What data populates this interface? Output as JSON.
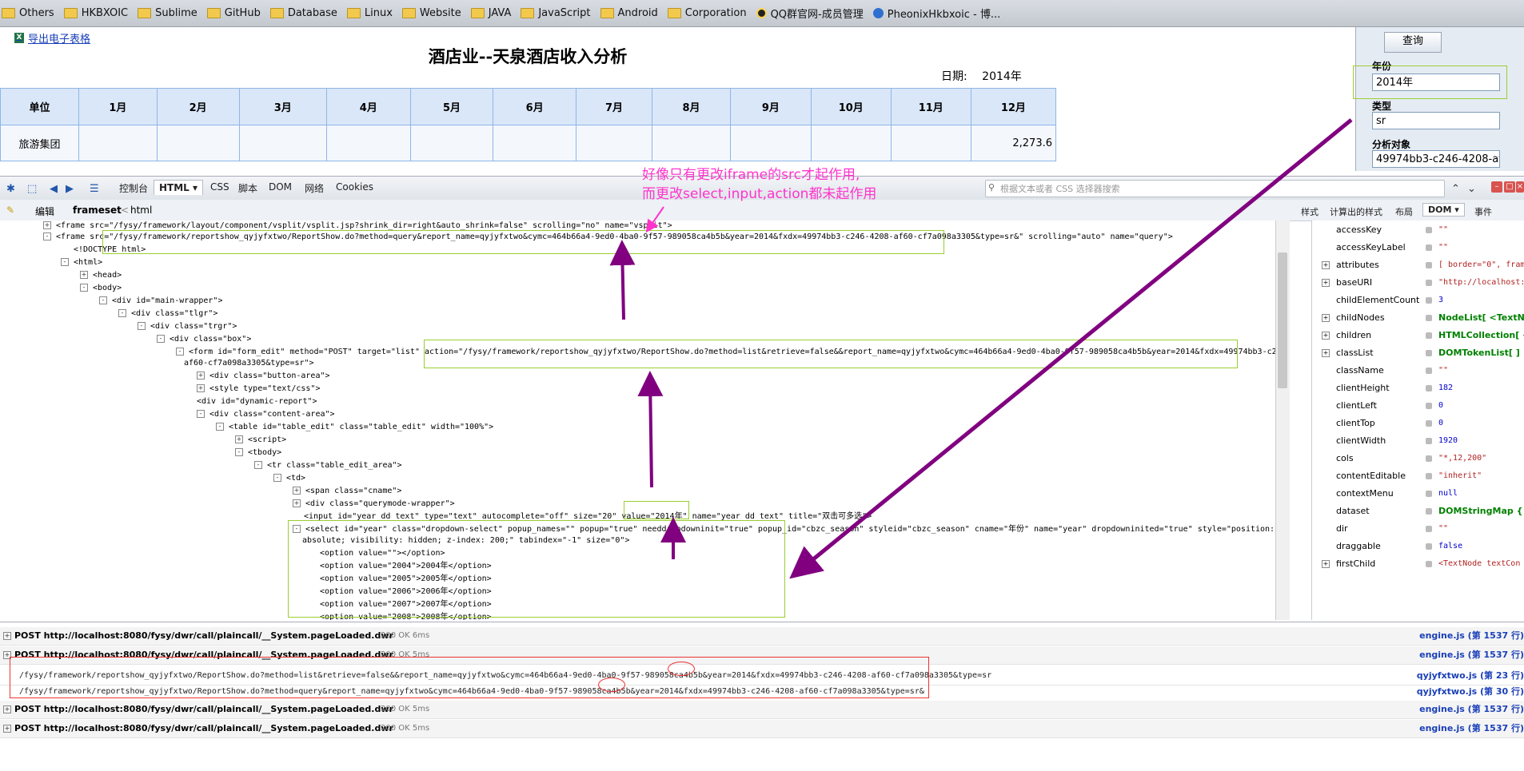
{
  "bookmarks": [
    {
      "label": "Others",
      "icon": "folder-icon"
    },
    {
      "label": "HKBXOIC",
      "icon": "folder-icon"
    },
    {
      "label": "Sublime",
      "icon": "folder-icon"
    },
    {
      "label": "GitHub",
      "icon": "folder-icon"
    },
    {
      "label": "Database",
      "icon": "folder-icon"
    },
    {
      "label": "Linux",
      "icon": "folder-icon"
    },
    {
      "label": "Website",
      "icon": "folder-icon"
    },
    {
      "label": "JAVA",
      "icon": "folder-icon"
    },
    {
      "label": "JavaScript",
      "icon": "folder-icon"
    },
    {
      "label": "Android",
      "icon": "folder-icon"
    },
    {
      "label": "Corporation",
      "icon": "folder-icon"
    },
    {
      "label": "QQ群官网-成员管理",
      "icon": "qq-icon"
    },
    {
      "label": "PheonixHkbxoic - 博...",
      "icon": "globe-icon"
    }
  ],
  "report": {
    "export_link": "导出电子表格",
    "title": "酒店业--天泉酒店收入分析",
    "date_label": "日期:",
    "date_value": "2014年",
    "headers": [
      "单位",
      "1月",
      "2月",
      "3月",
      "4月",
      "5月",
      "6月",
      "7月",
      "8月",
      "9月",
      "10月",
      "11月",
      "12月"
    ],
    "rows": [
      [
        "旅游集团",
        "",
        "",
        "",
        "",
        "",
        "",
        "",
        "",
        "",
        "",
        "",
        "2,273.6"
      ]
    ]
  },
  "query_panel": {
    "button": "查询",
    "year_label": "年份",
    "year_value": "2014年",
    "type_label": "类型",
    "type_value": "sr",
    "target_label": "分析对象",
    "target_value": "49974bb3-c246-4208-af"
  },
  "devtools": {
    "tabs": [
      "控制台",
      "HTML",
      "CSS",
      "脚本",
      "DOM",
      "网络",
      "Cookies"
    ],
    "active_tab": "HTML",
    "search_placeholder": "根据文本或者 CSS 选择器搜索",
    "edit": "编辑",
    "breadcrumb_current": "frameset",
    "breadcrumb_parent": "html",
    "side_tabs": [
      "样式",
      "计算出的样式",
      "布局",
      "DOM",
      "事件"
    ]
  },
  "annotation": {
    "line1": "好像只有更改iframe的src才起作用,",
    "line2": "而更改select,input,action都未起作用"
  },
  "tree": [
    "<frame src=\"/fysy/framework/layout/component/vsplit/vsplit.jsp?shrink_dir=right&auto_shrink=false\" scrolling=\"no\" name=\"vsplit\">",
    "<frame src=\"/fysy/framework/reportshow_qyjyfxtwo/ReportShow.do?method=query&report_name=qyjyfxtwo&cymc=464b66a4-9ed0-4ba0-9f57-989058ca4b5b&year=2014&fxdx=49974bb3-c246-4208-af60-cf7a098a3305&type=sr&\" scrolling=\"auto\" name=\"query\">",
    "<!DOCTYPE html>",
    "<html>",
    "<head>",
    "<body>",
    "<div id=\"main-wrapper\">",
    "<div class=\"tlgr\">",
    "<div class=\"trgr\">",
    "<div class=\"box\">",
    "<form id=\"form_edit\" method=\"POST\" target=\"list\" action=\"/fysy/framework/reportshow_qyjyfxtwo/ReportShow.do?method=list&retrieve=false&&report_name=qyjyfxtwo&cymc=464b66a4-9ed0-4ba0-9f57-989058ca4b5b&year=2014&fxdx=49974bb3-c246-4208-",
    "af60-cf7a098a3305&type=sr\">",
    "<div class=\"button-area\">",
    "<style type=\"text/css\">",
    "<div id=\"dynamic-report\">",
    "<div class=\"content-area\">",
    "<table id=\"table_edit\" class=\"table_edit\" width=\"100%\">",
    "<script>",
    "<tbody>",
    "<tr class=\"table_edit_area\">",
    "<td>",
    "<span class=\"cname\">",
    "<div class=\"querymode-wrapper\">",
    "<input id=\"year_dd_text\" type=\"text\" autocomplete=\"off\" size=\"20\" value=\"2014年\" name=\"year_dd_text\" title=\"双击可多选\">",
    "<select id=\"year\" class=\"dropdown-select\" popup_names=\"\" popup=\"true\" needdropdowninit=\"true\" popup_id=\"cbzc_season\" styleid=\"cbzc_season\" cname=\"年份\" name=\"year\" dropdowninited=\"true\" style=\"position:",
    "absolute; visibility: hidden; z-index: 200;\" tabindex=\"-1\" size=\"0\">",
    "<option value=\"\"></option>",
    "<option value=\"2004\">2004年</option>",
    "<option value=\"2005\">2005年</option>",
    "<option value=\"2006\">2006年</option>",
    "<option value=\"2007\">2007年</option>",
    "<option value=\"2008\">2008年</option>"
  ],
  "dom_props": [
    {
      "name": "accessKey",
      "value": "\"\"",
      "kind": "str",
      "expand": false
    },
    {
      "name": "accessKeyLabel",
      "value": "\"\"",
      "kind": "str",
      "expand": false
    },
    {
      "name": "attributes",
      "value": "[ border=\"0\", frame",
      "kind": "str",
      "expand": true
    },
    {
      "name": "baseURI",
      "value": "\"http://localhost:",
      "kind": "str",
      "expand": true
    },
    {
      "name": "childElementCount",
      "value": "3",
      "kind": "num",
      "expand": false
    },
    {
      "name": "childNodes",
      "value": "NodeList[ <TextNo",
      "kind": "obj",
      "expand": true
    },
    {
      "name": "children",
      "value": "HTMLCollection[ <f",
      "kind": "obj",
      "expand": true
    },
    {
      "name": "classList",
      "value": "DOMTokenList[ ]",
      "kind": "obj",
      "expand": true
    },
    {
      "name": "className",
      "value": "\"\"",
      "kind": "str",
      "expand": false
    },
    {
      "name": "clientHeight",
      "value": "182",
      "kind": "num",
      "expand": false
    },
    {
      "name": "clientLeft",
      "value": "0",
      "kind": "num",
      "expand": false
    },
    {
      "name": "clientTop",
      "value": "0",
      "kind": "num",
      "expand": false
    },
    {
      "name": "clientWidth",
      "value": "1920",
      "kind": "num",
      "expand": false
    },
    {
      "name": "cols",
      "value": "\"*,12,200\"",
      "kind": "str",
      "expand": false
    },
    {
      "name": "contentEditable",
      "value": "\"inherit\"",
      "kind": "str",
      "expand": false
    },
    {
      "name": "contextMenu",
      "value": "null",
      "kind": "num",
      "expand": false
    },
    {
      "name": "dataset",
      "value": "DOMStringMap {",
      "kind": "obj",
      "expand": false
    },
    {
      "name": "dir",
      "value": "\"\"",
      "kind": "str",
      "expand": false
    },
    {
      "name": "draggable",
      "value": "false",
      "kind": "num",
      "expand": false
    },
    {
      "name": "firstChild",
      "value": "<TextNode textCon",
      "kind": "str",
      "expand": true
    }
  ],
  "console": [
    {
      "type": "post",
      "text": "POST http://localhost:8080/fysy/dwr/call/plaincall/__System.pageLoaded.dwr",
      "status": "200 OK 6ms",
      "file": "engine.js (第 1537 行)"
    },
    {
      "type": "post",
      "text": "POST http://localhost:8080/fysy/dwr/call/plaincall/__System.pageLoaded.dwr",
      "status": "200 OK 5ms",
      "file": "engine.js (第 1537 行)"
    },
    {
      "type": "url",
      "text": "/fysy/framework/reportshow_qyjyfxtwo/ReportShow.do?method=list&retrieve=false&&report_name=qyjyfxtwo&cymc=464b66a4-9ed0-4ba0-9f57-989058ca4b5b&year=2014&fxdx=49974bb3-c246-4208-af60-cf7a098a3305&type=sr",
      "status": "",
      "file": "qyjyfxtwo.js (第 23 行)"
    },
    {
      "type": "url",
      "text": "/fysy/framework/reportshow_qyjyfxtwo/ReportShow.do?method=query&report_name=qyjyfxtwo&cymc=464b66a4-9ed0-4ba0-9f57-989058ca4b5b&year=2014&fxdx=49974bb3-c246-4208-af60-cf7a098a3305&type=sr&",
      "status": "",
      "file": "qyjyfxtwo.js (第 30 行)"
    },
    {
      "type": "post",
      "text": "POST http://localhost:8080/fysy/dwr/call/plaincall/__System.pageLoaded.dwr",
      "status": "200 OK 5ms",
      "file": "engine.js (第 1537 行)"
    },
    {
      "type": "post",
      "text": "POST http://localhost:8080/fysy/dwr/call/plaincall/__System.pageLoaded.dwr",
      "status": "200 OK 5ms",
      "file": "engine.js (第 1537 行)"
    }
  ],
  "colors": {
    "annotation": "#ff33cc",
    "arrow": "#800080",
    "highlight": "#9acd32",
    "mark": "#ee3333"
  }
}
